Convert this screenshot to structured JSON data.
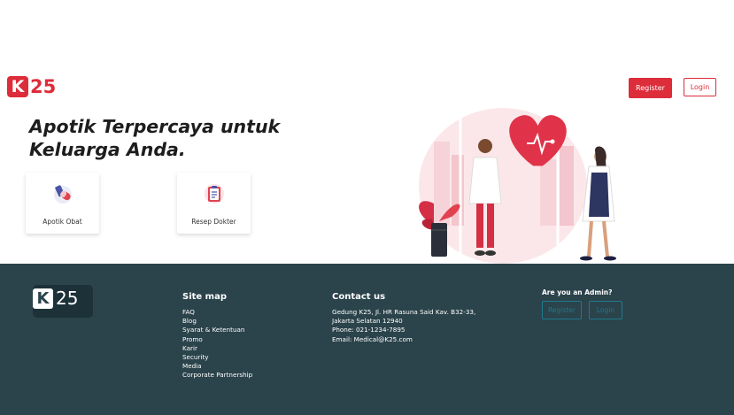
{
  "brand": {
    "logo_letter": "K",
    "logo_number": "25",
    "accent": "#dd2c3a",
    "footer_bg": "#2b434b"
  },
  "header": {
    "register_label": "Register",
    "login_label": "Login"
  },
  "hero": {
    "title": "Apotik Terpercaya untuk Keluarga Anda."
  },
  "services": [
    {
      "label": "Apotik Obat",
      "icon": "pill-bottle-icon"
    },
    {
      "label": "Resep Dokter",
      "icon": "prescription-clipboard-icon"
    }
  ],
  "footer": {
    "sitemap": {
      "title": "Site map",
      "items": [
        "FAQ",
        "Blog",
        "Syarat & Ketentuan",
        "Promo",
        "Karir",
        "Security",
        "Media",
        "Corporate Partnership"
      ]
    },
    "contact": {
      "title": "Contact us",
      "lines": [
        "Gedung K25, Jl. HR Rasuna Said Kav. B32-33,",
        "Jakarta Selatan 12940",
        "Phone: 021-1234-7895",
        "Email: Medical@K25.com"
      ]
    },
    "admin": {
      "title": "Are you an Admin?",
      "register_label": "Register",
      "login_label": "Login"
    }
  }
}
